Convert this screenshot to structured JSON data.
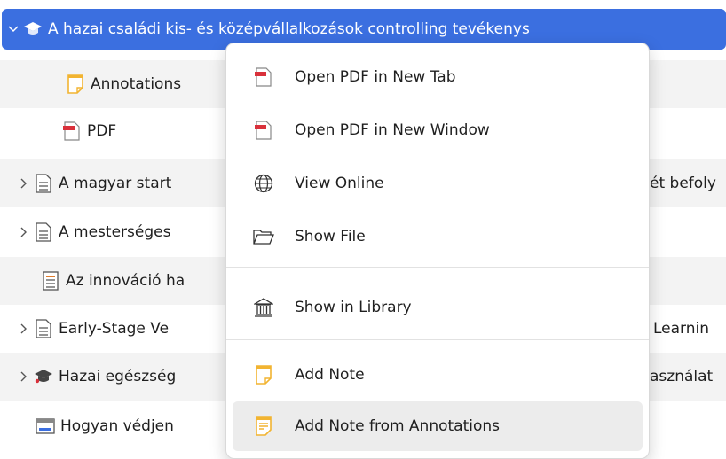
{
  "tree": {
    "rows": [
      {
        "icon": "graduation-cap-icon",
        "title": "A hazai családi kis- és középvállalkozások controlling tevékenys",
        "expanded": true,
        "selected": true
      },
      {
        "icon": "note-icon",
        "title": "Annotations"
      },
      {
        "icon": "pdf-icon",
        "title": "PDF"
      },
      {
        "icon": "document-icon",
        "title": "A magyar start",
        "tail": "ét befoly"
      },
      {
        "icon": "document-icon",
        "title": "A mesterséges"
      },
      {
        "icon": "report-icon",
        "title": "Az innováció ha"
      },
      {
        "icon": "document-icon",
        "title": "Early-Stage Ve",
        "tail": "Learnin"
      },
      {
        "icon": "graduation-cap-icon",
        "title": "Hazai egészség",
        "tail": "asználat"
      },
      {
        "icon": "web-page-icon",
        "title": "Hogyan védjen"
      }
    ]
  },
  "context_menu": {
    "items": [
      {
        "label": "Open PDF in New Tab",
        "icon": "pdf-icon"
      },
      {
        "label": "Open PDF in New Window",
        "icon": "pdf-icon"
      },
      {
        "label": "View Online",
        "icon": "globe-icon"
      },
      {
        "label": "Show File",
        "icon": "folder-icon"
      },
      {
        "label": "Show in Library",
        "icon": "library-icon"
      },
      {
        "label": "Add Note",
        "icon": "note-icon"
      },
      {
        "label": "Add Note from Annotations",
        "icon": "note-annotations-icon"
      }
    ]
  },
  "colors": {
    "selection": "#3b6fe0",
    "row_alt": "#f3f3f3",
    "pdf_red": "#d9313b",
    "note_yellow": "#f2b431"
  }
}
